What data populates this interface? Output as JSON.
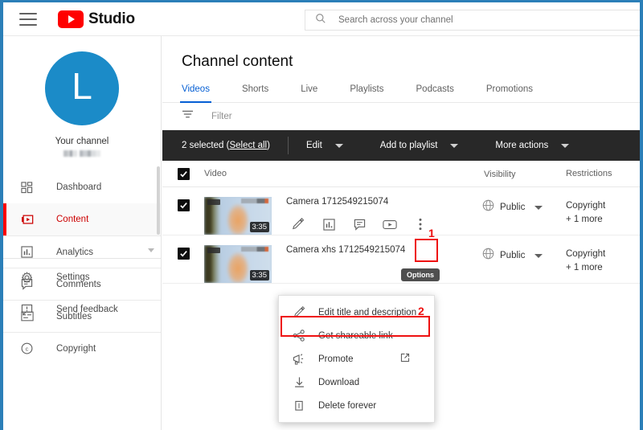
{
  "window": {
    "border_color": "#2b7fb8"
  },
  "topbar": {
    "menu_icon": "hamburger-icon",
    "brand": "Studio",
    "logo_icon": "youtube-logo-icon"
  },
  "search": {
    "icon": "search-icon",
    "placeholder": "Search across your channel",
    "value": ""
  },
  "sidebar": {
    "avatar_letter": "L",
    "avatar_color": "#1b8bc8",
    "your_channel_label": "Your channel",
    "channel_name": "",
    "items": [
      {
        "label": "Dashboard",
        "icon": "dashboard-icon",
        "active": false
      },
      {
        "label": "Content",
        "icon": "content-video-icon",
        "active": true
      },
      {
        "label": "Analytics",
        "icon": "analytics-bars-icon",
        "active": false
      },
      {
        "label": "Comments",
        "icon": "comment-bubble-icon",
        "active": false
      },
      {
        "label": "Subtitles",
        "icon": "subtitles-icon",
        "active": false
      },
      {
        "label": "Copyright",
        "icon": "copyright-icon",
        "active": false
      }
    ],
    "footer_items": [
      {
        "label": "Settings",
        "icon": "gear-icon"
      },
      {
        "label": "Send feedback",
        "icon": "feedback-icon"
      }
    ]
  },
  "main": {
    "page_title": "Channel content",
    "tabs": [
      {
        "label": "Videos",
        "active": true
      },
      {
        "label": "Shorts",
        "active": false
      },
      {
        "label": "Live",
        "active": false
      },
      {
        "label": "Playlists",
        "active": false
      },
      {
        "label": "Podcasts",
        "active": false
      },
      {
        "label": "Promotions",
        "active": false
      }
    ],
    "filter": {
      "icon": "filter-icon",
      "placeholder": "Filter"
    },
    "selection_toolbar": {
      "count_text": "2 selected (",
      "select_all_label": "Select all",
      "count_text_end": ")",
      "buttons": [
        {
          "label": "Edit"
        },
        {
          "label": "Add to playlist"
        },
        {
          "label": "More actions"
        }
      ]
    },
    "table": {
      "headers": {
        "video": "Video",
        "visibility": "Visibility",
        "restrictions": "Restrictions"
      },
      "rows": [
        {
          "checked": true,
          "title": "Camera 1712549215074",
          "duration": "3:35",
          "visibility": "Public",
          "visibility_icon": "globe-icon",
          "restrictions_line1": "Copyright",
          "restrictions_line2": "+ 1 more",
          "actions": [
            {
              "icon": "pencil-edit-icon"
            },
            {
              "icon": "analytics-bars-icon"
            },
            {
              "icon": "comment-bubble-icon"
            },
            {
              "icon": "video-player-icon"
            },
            {
              "icon": "three-dots-options-icon"
            }
          ]
        },
        {
          "checked": true,
          "title": "Camera xhs 1712549215074",
          "duration": "3:35",
          "visibility": "Public",
          "visibility_icon": "globe-icon",
          "restrictions_line1": "Copyright",
          "restrictions_line2": "+ 1 more"
        }
      ]
    }
  },
  "tooltip": {
    "text": "Options"
  },
  "context_menu": {
    "items": [
      {
        "label": "Edit title and description",
        "icon": "pencil-edit-icon",
        "external": false,
        "highlighted": false
      },
      {
        "label": "Get shareable link",
        "icon": "share-nodes-icon",
        "external": false,
        "highlighted": true
      },
      {
        "label": "Promote",
        "icon": "megaphone-icon",
        "external": true,
        "highlighted": false
      },
      {
        "label": "Download",
        "icon": "download-arrow-icon",
        "external": false,
        "highlighted": false
      },
      {
        "label": "Delete forever",
        "icon": "trash-bin-icon",
        "external": false,
        "highlighted": false
      }
    ]
  },
  "annotations": {
    "step1": "1",
    "step2": "2",
    "color": "#ee1111"
  }
}
